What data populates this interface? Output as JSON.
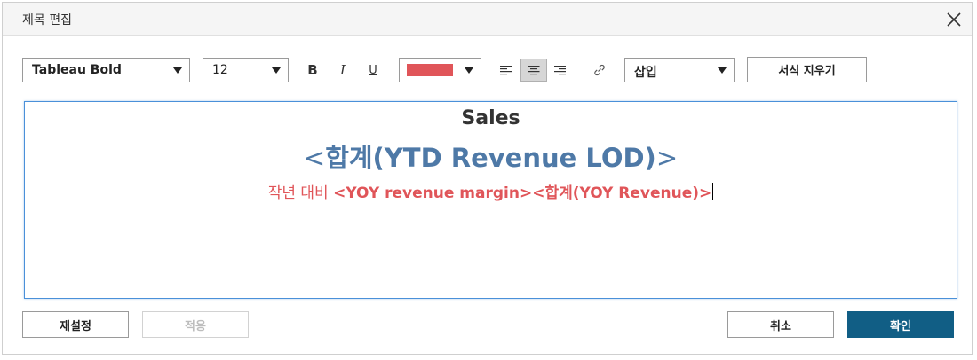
{
  "dialog": {
    "title": "제목 편집",
    "close_icon": "close-icon"
  },
  "toolbar": {
    "font_family": "Tableau Bold",
    "font_size": "12",
    "bold_label": "B",
    "italic_label": "I",
    "underline_label": "U",
    "text_color": "#e05559",
    "insert_label": "삽입",
    "clear_format_label": "서식 지우기",
    "align_left_icon": "align-left-icon",
    "align_center_icon": "align-center-icon",
    "align_right_icon": "align-right-icon",
    "link_icon": "link-icon",
    "align_center_active": true
  },
  "editor": {
    "line1": "Sales",
    "line2_lt": "<",
    "line2_field": "합계(YTD Revenue LOD)",
    "line2_gt": ">",
    "line3_prefix": "작년 대비 ",
    "line3_field1": "<YOY revenue margin>",
    "line3_field2": "<합계(YOY Revenue)>",
    "colors": {
      "title": "#333333",
      "field_blue": "#4e79a7",
      "field_red": "#e05559"
    }
  },
  "footer": {
    "reset_label": "재설정",
    "apply_label": "적용",
    "cancel_label": "취소",
    "ok_label": "확인",
    "ok_color": "#115e85"
  }
}
